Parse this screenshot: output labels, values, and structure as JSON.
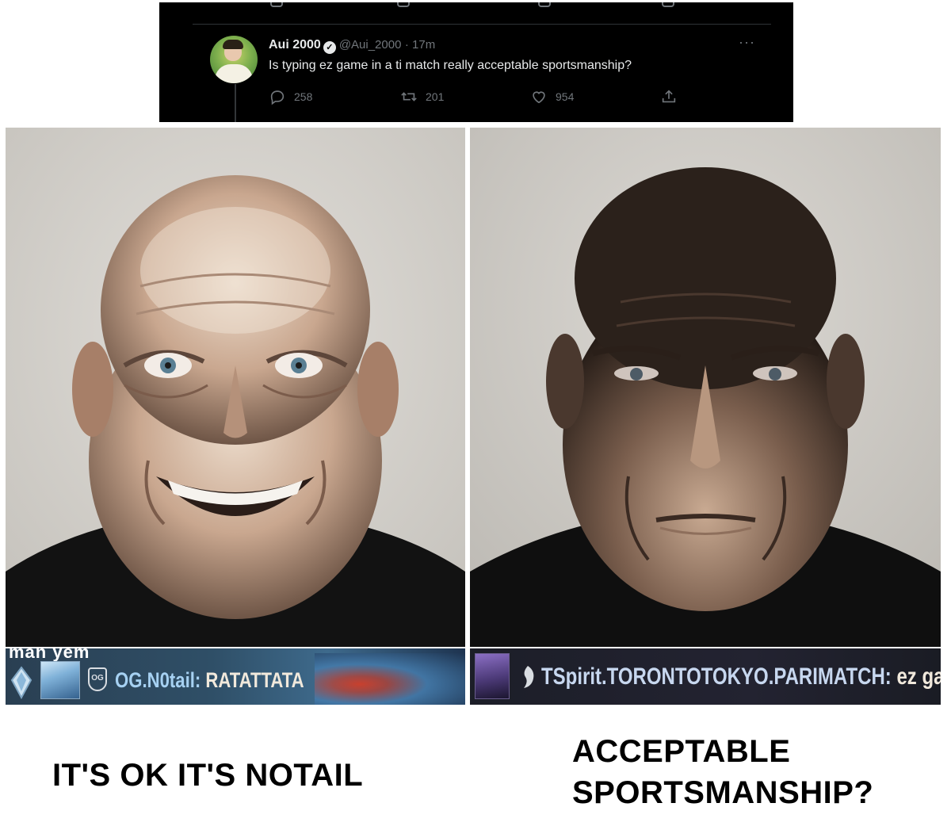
{
  "tweet": {
    "author_name": "Aui 2000",
    "verified_glyph": "✓",
    "handle": "@Aui_2000",
    "time": "· 17m",
    "more_glyph": "···",
    "text": "Is typing ez game in a ti match really acceptable sportsmanship?",
    "replies": "258",
    "retweets": "201",
    "likes": "954",
    "icons": [
      "reply-icon",
      "retweet-icon",
      "like-icon",
      "share-icon"
    ],
    "colors": {
      "background": "#000000",
      "text": "#e7e9ea",
      "muted": "#71767b"
    }
  },
  "photos": {
    "left": {
      "expression": "smiling"
    },
    "right": {
      "expression": "stern"
    }
  },
  "chat_left": {
    "partial_text": "man yem",
    "team_logo": "OG",
    "player": "OG.N0tail:",
    "message": "RATATTATA"
  },
  "chat_right": {
    "player": "TSpirit.TORONTOTOKYO.PARIMATCH:",
    "message": "ez game"
  },
  "captions": {
    "left": "IT'S OK IT'S NOTAIL",
    "right_line1": "ACCEPTABLE",
    "right_line2": "SPORTSMANSHIP?"
  }
}
